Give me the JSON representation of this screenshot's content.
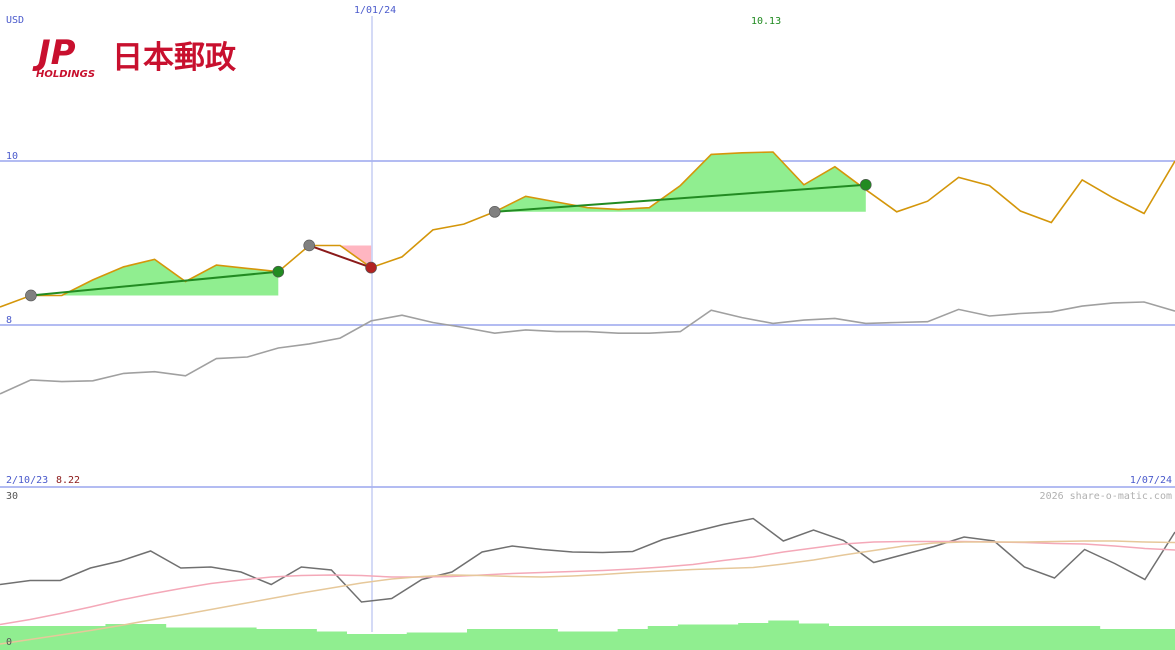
{
  "brand": {
    "logo_mark": "JP",
    "logo_sub": "HOLDINGS",
    "logo_name": "日本郵政",
    "color": "#c8102e"
  },
  "chart_data": [
    {
      "type": "line",
      "currency": "USD",
      "current_value": "10.13",
      "date_marker": "1/01/24",
      "start_date": "2/10/23",
      "start_value": "8.22",
      "end_date": "1/07/24",
      "ylim": [
        6.0,
        10.0
      ],
      "yticks": [
        10,
        8
      ],
      "grid": "horizontal lines at 10 and 8; vertical line at 1/01/24",
      "watermark": "2026 share-o-matic.com",
      "x_index_range": [
        0,
        38
      ],
      "date_marker_index": 12,
      "series": [
        {
          "color": "#d4960a",
          "values": [
            8.22,
            8.36,
            8.36,
            8.55,
            8.71,
            8.8,
            8.53,
            8.73,
            8.69,
            8.65,
            8.97,
            8.97,
            8.7,
            8.83,
            9.16,
            9.23,
            9.38,
            9.57,
            9.5,
            9.43,
            9.41,
            9.43,
            9.7,
            10.08,
            10.1,
            10.11,
            9.71,
            9.93,
            9.65,
            9.38,
            9.51,
            9.8,
            9.7,
            9.39,
            9.25,
            9.77,
            9.55,
            9.36,
            10.0
          ]
        },
        {
          "color": "#a0a0a0",
          "values": [
            7.16,
            7.33,
            7.31,
            7.32,
            7.41,
            7.43,
            7.38,
            7.59,
            7.61,
            7.72,
            7.77,
            7.84,
            8.05,
            8.12,
            8.03,
            7.97,
            7.9,
            7.94,
            7.92,
            7.92,
            7.9,
            7.9,
            7.92,
            8.18,
            8.09,
            8.02,
            8.06,
            8.08,
            8.02,
            8.03,
            8.04,
            8.19,
            8.11,
            8.14,
            8.16,
            8.23,
            8.27,
            8.28,
            8.17
          ]
        }
      ],
      "trend_lines": [
        {
          "from_index": 1,
          "to_index": 9,
          "from_value": 8.36,
          "to_value": 8.65,
          "color": "#228b22",
          "fill": "#90ee90"
        },
        {
          "from_index": 10,
          "to_index": 12,
          "from_value": 8.97,
          "to_value": 8.7,
          "color": "#8b1a1a",
          "fill": "#ffb6c1"
        },
        {
          "from_index": 16,
          "to_index": 28,
          "from_value": 9.38,
          "to_value": 9.71,
          "color": "#228b22",
          "fill": "#90ee90"
        }
      ],
      "markers": [
        {
          "index": 1,
          "value": 8.36,
          "color": "#808080"
        },
        {
          "index": 9,
          "value": 8.65,
          "color": "#228b22"
        },
        {
          "index": 10,
          "value": 8.97,
          "color": "#808080"
        },
        {
          "index": 12,
          "value": 8.7,
          "color": "#b22222"
        },
        {
          "index": 16,
          "value": 9.38,
          "color": "#808080"
        },
        {
          "index": 28,
          "value": 9.71,
          "color": "#228b22"
        }
      ]
    },
    {
      "type": "line",
      "ylim": [
        0,
        30
      ],
      "yticks": [
        30,
        0
      ],
      "series": [
        {
          "color": "#707070",
          "values": [
            12.5,
            13.3,
            13.3,
            15.8,
            17.2,
            19.2,
            15.8,
            16.0,
            15.0,
            12.5,
            16.0,
            15.4,
            9.0,
            9.7,
            13.5,
            15.0,
            19.0,
            20.2,
            19.5,
            19.0,
            18.9,
            19.1,
            21.5,
            23.0,
            24.5,
            25.7,
            21.2,
            23.4,
            21.3,
            16.9,
            18.5,
            20.1,
            22.0,
            21.2,
            16.0,
            13.8,
            19.5,
            16.7,
            13.5,
            23.0
          ]
        },
        {
          "color": "#f4a8b8",
          "values": [
            4.5,
            5.5,
            6.7,
            8.0,
            9.4,
            10.6,
            11.7,
            12.7,
            13.4,
            14.0,
            14.3,
            14.4,
            14.3,
            14.0,
            14.0,
            14.1,
            14.4,
            14.7,
            14.9,
            15.1,
            15.3,
            15.6,
            16.0,
            16.5,
            17.3,
            18.0,
            19.0,
            19.8,
            20.6,
            21.0,
            21.1,
            21.1,
            21.1,
            21.0,
            20.9,
            20.7,
            20.6,
            20.2,
            19.7,
            19.4
          ]
        },
        {
          "color": "#e6c89a",
          "values": [
            0.6,
            1.5,
            2.4,
            3.3,
            4.3,
            5.4,
            6.4,
            7.5,
            8.6,
            9.7,
            10.8,
            11.8,
            12.8,
            13.6,
            14.1,
            14.4,
            14.3,
            14.1,
            14.0,
            14.2,
            14.5,
            14.9,
            15.2,
            15.5,
            15.7,
            15.9,
            16.6,
            17.4,
            18.4,
            19.3,
            20.2,
            20.8,
            21.0,
            21.0,
            21.0,
            21.1,
            21.2,
            21.2,
            21.0,
            20.9
          ]
        },
        {
          "color": "#90ee90",
          "style": "bars",
          "values": [
            4.2,
            4.2,
            4.2,
            4.2,
            4.6,
            4.6,
            3.9,
            3.9,
            3.9,
            3.6,
            3.6,
            3.1,
            2.6,
            2.6,
            2.9,
            2.9,
            3.6,
            3.6,
            3.6,
            3.1,
            3.1,
            3.6,
            4.2,
            4.5,
            4.5,
            4.8,
            5.3,
            4.7,
            4.2,
            4.2,
            4.2,
            4.2,
            4.2,
            4.2,
            4.2,
            4.2,
            4.2,
            3.6,
            3.6,
            3.6
          ]
        }
      ]
    }
  ]
}
